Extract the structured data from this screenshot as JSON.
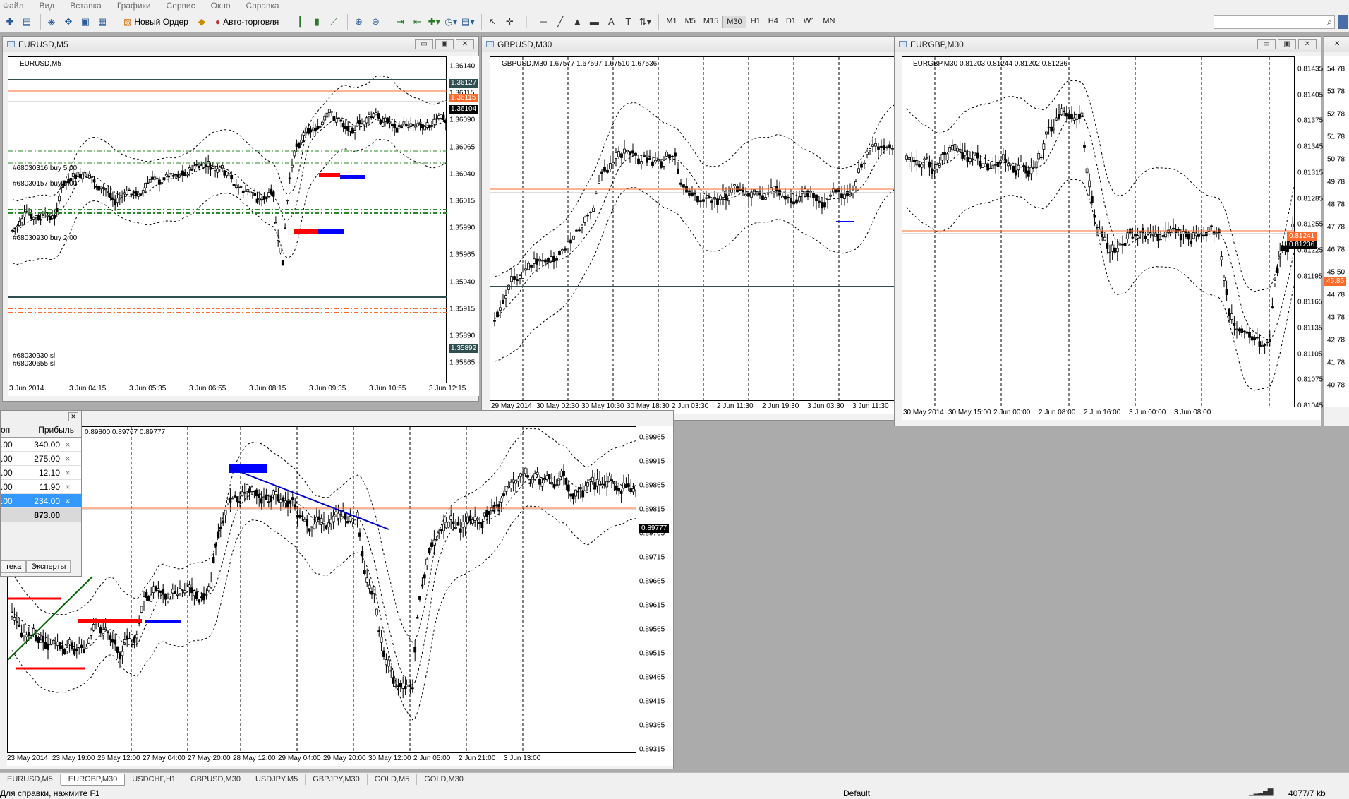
{
  "menu": [
    "Файл",
    "Вид",
    "Вставка",
    "Графики",
    "Сервис",
    "Окно",
    "Справка"
  ],
  "toolbar": {
    "new_order": "Новый Ордер",
    "auto_trading": "Авто-торговля",
    "timeframes": [
      "M1",
      "M5",
      "M15",
      "M30",
      "H1",
      "H4",
      "D1",
      "W1",
      "MN"
    ],
    "active_timeframe": "M30",
    "icons": [
      "new-chart-icon",
      "profiles-icon",
      "market-watch-icon",
      "navigator-icon",
      "terminal-icon",
      "tester-icon",
      "bars-icon",
      "candles-icon",
      "line-chart-icon",
      "zoom-in-icon",
      "zoom-out-icon",
      "autoscroll-icon",
      "chart-shift-icon",
      "indicators-icon",
      "periods-icon",
      "templates-icon",
      "cursor-icon",
      "crosshair-icon",
      "vertical-line-icon",
      "horizontal-line-icon",
      "trendline-icon",
      "channel-icon",
      "fibonacci-icon",
      "text-icon",
      "label-icon",
      "arrows-icon"
    ]
  },
  "windows": {
    "eurusd": {
      "title": "EURUSD,M5",
      "label": "EURUSD,M5",
      "price_ticks": [
        "1.36140",
        "1.36115",
        "1.36090",
        "1.36065",
        "1.36040",
        "1.36015",
        "1.35990",
        "1.35965",
        "1.35940",
        "1.35915",
        "1.35890",
        "1.35865"
      ],
      "tags": {
        "green_top": "1.36127",
        "orange": "1.36115",
        "black": "1.36104",
        "green_bottom": "1.35892"
      },
      "time_ticks": [
        "3 Jun 2014",
        "3 Jun 04:15",
        "3 Jun 05:35",
        "3 Jun 06:55",
        "3 Jun 08:15",
        "3 Jun 09:35",
        "3 Jun 10:55",
        "3 Jun 12:15"
      ],
      "orders": [
        "#68030316 buy 5.00",
        "#68030157 buy 5.00",
        "#68030930 buy 2.00",
        "#68030930 sl",
        "#68030655 sl"
      ]
    },
    "gbpusd": {
      "title": "GBPUSD,M30",
      "label": "GBPUSD,M30  1.67577 1.67597 1.67510 1.67536",
      "time_ticks": [
        "29 May 2014",
        "30 May 02:30",
        "30 May 10:30",
        "30 May 18:30",
        "2 Jun 03:30",
        "2 Jun 11:30",
        "2 Jun 19:30",
        "3 Jun 03:30",
        "3 Jun 11:30"
      ]
    },
    "eurgbp_top": {
      "title": "EURGBP,M30",
      "label": "EURGBP,M30  0.81203 0.81244 0.81202 0.81236",
      "price_ticks": [
        "0.81435",
        "0.81405",
        "0.81375",
        "0.81345",
        "0.81315",
        "0.81285",
        "0.81255",
        "0.81225",
        "0.81195",
        "0.81165",
        "0.81135",
        "0.81105",
        "0.81075",
        "0.81045"
      ],
      "tags": {
        "orange": "0.81241",
        "black": "0.81236"
      },
      "time_ticks": [
        "30 May 2014",
        "30 May 15:00",
        "2 Jun 00:00",
        "2 Jun 08:00",
        "2 Jun 16:00",
        "3 Jun 00:00",
        "3 Jun 08:00"
      ]
    },
    "right_partial": {
      "ticks": [
        "54.78",
        "53.78",
        "52.78",
        "51.78",
        "50.78",
        "49.78",
        "48.78",
        "47.78",
        "46.78",
        "45.50",
        "44.78",
        "43.78",
        "42.78",
        "41.78",
        "40.78"
      ],
      "tag_orange": "45.85"
    },
    "eurgbp_bottom": {
      "label": "0.89800 0.89767 0.89777",
      "price_ticks": [
        "0.89965",
        "0.89915",
        "0.89865",
        "0.89815",
        "0.89765",
        "0.89715",
        "0.89665",
        "0.89615",
        "0.89565",
        "0.89515",
        "0.89465",
        "0.89415",
        "0.89365",
        "0.89315"
      ],
      "tag": "0.89777",
      "time_ticks": [
        "23 May 2014",
        "23 May 19:00",
        "26 May 12:00",
        "27 May 04:00",
        "27 May 20:00",
        "28 May 12:00",
        "29 May 04:00",
        "29 May 20:00",
        "30 May 12:00",
        "2 Jun 05:00",
        "2 Jun 21:00",
        "3 Jun 13:00"
      ]
    }
  },
  "trade_panel": {
    "col1": "оп",
    "col2": "Прибыль",
    "rows": [
      {
        "a": ".00",
        "profit": "340.00"
      },
      {
        "a": ".00",
        "profit": "275.00"
      },
      {
        "a": ".00",
        "profit": "12.10"
      },
      {
        "a": ".00",
        "profit": "11.90"
      },
      {
        "a": ".00",
        "profit": "234.00",
        "selected": true
      }
    ],
    "total": "873.00",
    "tabs": [
      "тека",
      "Эксперты"
    ]
  },
  "bottom_tabs": [
    "EURUSD,M5",
    "EURGBP,M30",
    "USDCHF,H1",
    "GBPUSD,M30",
    "USDJPY,M5",
    "GBPJPY,M30",
    "GOLD,M5",
    "GOLD,M30"
  ],
  "active_tab": "EURGBP,M30",
  "status": {
    "help": "Для справки, нажмите F1",
    "profile": "Default",
    "traffic": "4077/7 kb"
  },
  "colors": {
    "bull": "#000000",
    "bear": "#000000",
    "bid": "#ff6a2a",
    "background": "#ababab",
    "buy": "#0000ff",
    "sell": "#ff0000"
  }
}
